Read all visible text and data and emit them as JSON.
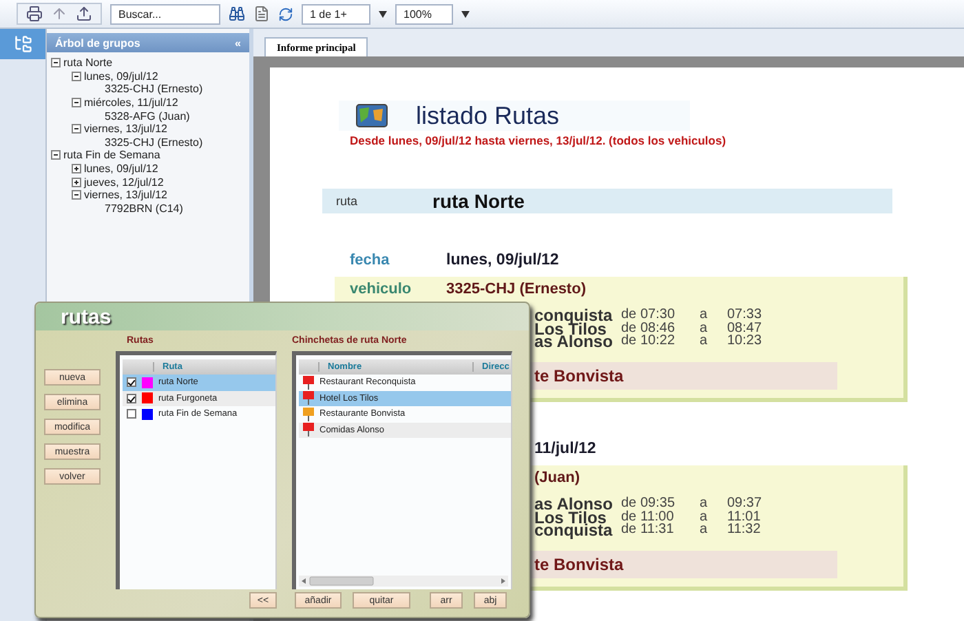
{
  "toolbar": {
    "search": {
      "placeholder": "Buscar..."
    },
    "page": {
      "value": "1 de 1+"
    },
    "zoom": {
      "value": "100%"
    }
  },
  "tree_panel": {
    "title": "Árbol de grupos",
    "collapse": "«",
    "items": [
      {
        "label": "ruta Norte",
        "expanded": true,
        "children": [
          {
            "label": "lunes, 09/jul/12",
            "expanded": true,
            "children": [
              {
                "label": "3325-CHJ (Ernesto)"
              }
            ]
          },
          {
            "label": "miércoles, 11/jul/12",
            "expanded": true,
            "children": [
              {
                "label": "5328-AFG (Juan)"
              }
            ]
          },
          {
            "label": "viernes, 13/jul/12",
            "expanded": true,
            "children": [
              {
                "label": "3325-CHJ (Ernesto)"
              }
            ]
          }
        ]
      },
      {
        "label": "ruta Fin de Semana",
        "expanded": true,
        "children": [
          {
            "label": "lunes, 09/jul/12",
            "expanded": false
          },
          {
            "label": "jueves, 12/jul/12",
            "expanded": false
          },
          {
            "label": "viernes, 13/jul/12",
            "expanded": true,
            "children": [
              {
                "label": "7792BRN (C14)"
              }
            ]
          }
        ]
      }
    ]
  },
  "tabs": [
    {
      "label": "Informe principal",
      "selected": true
    }
  ],
  "report": {
    "title": "listado Rutas",
    "subtitle": "Desde lunes, 09/jul/12 hasta viernes, 13/jul/12.  (todos los vehiculos)",
    "route_label": "ruta",
    "route_name": "ruta Norte",
    "days": [
      {
        "date_label": "fecha",
        "date": "lunes, 09/jul/12",
        "vehicle_label": "vehiculo",
        "vehicle": "3325-CHJ (Ernesto)",
        "stops": [
          {
            "name": "conquista",
            "from_label": "de",
            "from": "07:30",
            "to_label": "a",
            "to": "07:33"
          },
          {
            "name": "Los Tilos",
            "from_label": "de",
            "from": "08:46",
            "to_label": "a",
            "to": "08:47"
          },
          {
            "name": "as Alonso",
            "from_label": "de",
            "from": "10:22",
            "to_label": "a",
            "to": "10:23"
          }
        ],
        "footer": "te Bonvista"
      },
      {
        "date": "11/jul/12",
        "vehicle": "(Juan)",
        "stops": [
          {
            "name": "as Alonso",
            "from_label": "de",
            "from": "09:35",
            "to_label": "a",
            "to": "09:37"
          },
          {
            "name": "Los Tilos",
            "from_label": "de",
            "from": "11:00",
            "to_label": "a",
            "to": "11:01"
          },
          {
            "name": "conquista",
            "from_label": "de",
            "from": "11:31",
            "to_label": "a",
            "to": "11:32"
          }
        ],
        "footer": "te Bonvista"
      }
    ]
  },
  "dialog": {
    "title": "rutas",
    "side_buttons": [
      "nueva",
      "elimina",
      "modifica",
      "muestra",
      "volver"
    ],
    "routes": {
      "label": "Rutas",
      "column": "Ruta",
      "rows": [
        {
          "name": "ruta Norte",
          "checked": true,
          "color": "#ff00ff",
          "selected": true
        },
        {
          "name": "ruta Furgoneta",
          "checked": true,
          "color": "#ff0000",
          "selected": false
        },
        {
          "name": "ruta Fin de Semana",
          "checked": false,
          "color": "#0000ff",
          "selected": false
        }
      ],
      "button": "<<"
    },
    "pins": {
      "label": "Chinchetas de ruta Norte",
      "columns": [
        "Nombre",
        "Direcc"
      ],
      "rows": [
        {
          "name": "Restaurant Reconquista",
          "color": "#e82020",
          "selected": false
        },
        {
          "name": "Hotel Los Tilos",
          "color": "#e82020",
          "selected": true
        },
        {
          "name": "Restaurante Bonvista",
          "color": "#f0a020",
          "selected": false
        },
        {
          "name": "Comidas Alonso",
          "color": "#e82020",
          "selected": false
        }
      ],
      "buttons": [
        "añadir",
        "quitar",
        "arr",
        "abj"
      ]
    }
  }
}
